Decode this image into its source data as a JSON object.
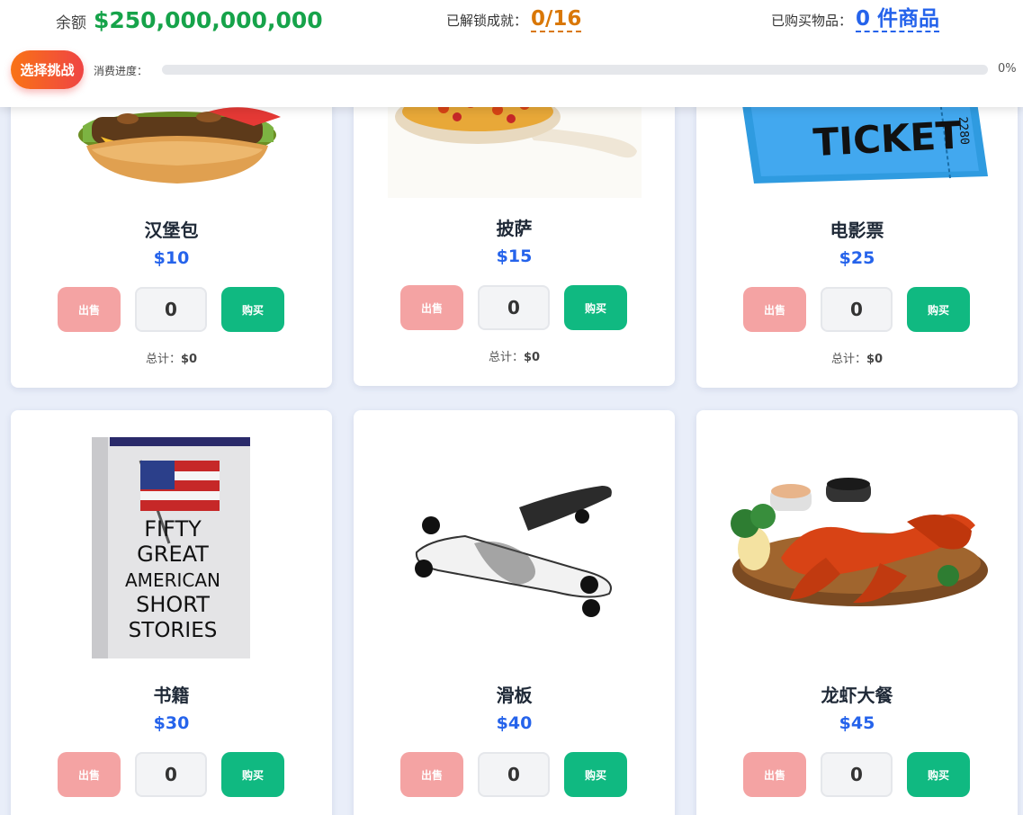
{
  "header": {
    "balance_label": "余额",
    "balance_value": "$250,000,000,000",
    "achievements_label": "已解锁成就：",
    "achievements_value": "0/16",
    "bought_label": "已购买物品：",
    "bought_value": "0 件商品",
    "challenge_button": "选择挑战",
    "progress_label": "消费进度：",
    "progress_percent_text": "0%",
    "progress_fraction": 0
  },
  "products": [
    {
      "name": "汉堡包",
      "price": "$10",
      "sell_label": "出售",
      "buy_label": "购买",
      "quantity": "0",
      "total_label": "总计：",
      "total_value": "$0",
      "icon": "burger-image"
    },
    {
      "name": "披萨",
      "price": "$15",
      "sell_label": "出售",
      "buy_label": "购买",
      "quantity": "0",
      "total_label": "总计：",
      "total_value": "$0",
      "icon": "pizza-image"
    },
    {
      "name": "电影票",
      "price": "$25",
      "sell_label": "出售",
      "buy_label": "购买",
      "quantity": "0",
      "total_label": "总计：",
      "total_value": "$0",
      "icon": "ticket-image",
      "image_text": "TICKET",
      "image_number": "2280"
    },
    {
      "name": "书籍",
      "price": "$30",
      "sell_label": "出售",
      "buy_label": "购买",
      "quantity": "0",
      "icon": "book-image",
      "image_text": [
        "FIFTY",
        "GREAT",
        "AMERICAN",
        "SHORT",
        "STORIES"
      ]
    },
    {
      "name": "滑板",
      "price": "$40",
      "sell_label": "出售",
      "buy_label": "购买",
      "quantity": "0",
      "icon": "skateboard-image"
    },
    {
      "name": "龙虾大餐",
      "price": "$45",
      "sell_label": "出售",
      "buy_label": "购买",
      "quantity": "0",
      "icon": "lobster-image"
    }
  ],
  "colors": {
    "balance": "#16a34a",
    "achievements": "#d97706",
    "bought": "#2563eb",
    "price": "#2563eb",
    "buy_button": "#10b981",
    "sell_button": "#f4a3a3"
  }
}
